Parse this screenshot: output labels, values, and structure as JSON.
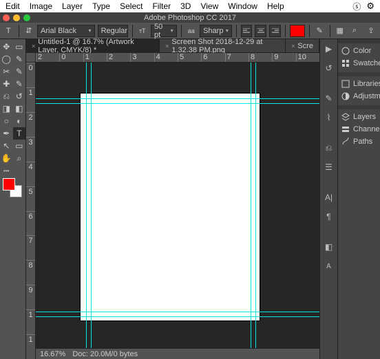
{
  "menubar": {
    "items": [
      "Edit",
      "Image",
      "Layer",
      "Type",
      "Select",
      "Filter",
      "3D",
      "View",
      "Window",
      "Help"
    ]
  },
  "title": "Adobe Photoshop CC 2017",
  "options": {
    "font": "Arial Black",
    "style": "Regular",
    "size_label": "50 pt",
    "antialiasing": "Sharp",
    "color": "#ff0000"
  },
  "tabs": [
    {
      "label": "Untitled-1 @ 16.7% (Artwork Layer, CMYK/8) *",
      "active": true
    },
    {
      "label": "Screen Shot 2018-12-29 at 1.32.38 PM.png",
      "active": false
    },
    {
      "label": "Scre",
      "active": false
    }
  ],
  "ruler_h": [
    "2",
    "0",
    "1",
    "2",
    "3",
    "4",
    "5",
    "6",
    "7",
    "8",
    "9",
    "10"
  ],
  "ruler_v": [
    "0",
    "1",
    "2",
    "3",
    "4",
    "5",
    "6",
    "7",
    "8",
    "9",
    "1",
    "1"
  ],
  "status": {
    "zoom": "16.67%",
    "info": "Doc: 20.0M/0 bytes"
  },
  "panels": [
    "Color",
    "Swatches",
    "Libraries",
    "Adjustment.",
    "Layers",
    "Channels",
    "Paths"
  ],
  "fg_color": "#ff0000",
  "bg_color": "#ffffff"
}
